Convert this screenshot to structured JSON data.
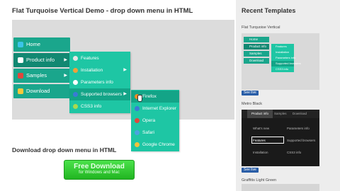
{
  "demo": {
    "title": "Flat Turquoise Vertical Demo - drop down menu in HTML",
    "menu": [
      {
        "label": "Home",
        "icon": "home-icon",
        "icon_color": "#3cc4e8",
        "has_sub": false
      },
      {
        "label": "Product info",
        "icon": "document-icon",
        "icon_color": "#ffffff",
        "has_sub": true
      },
      {
        "label": "Samples",
        "icon": "heart-icon",
        "icon_color": "#e0473d",
        "has_sub": true
      },
      {
        "label": "Download",
        "icon": "download-icon",
        "icon_color": "#f5c83a",
        "has_sub": false
      }
    ],
    "submenu": [
      {
        "label": "Features",
        "icon": "star-icon",
        "icon_color": "#e6e6e6",
        "has_sub": false
      },
      {
        "label": "Installation",
        "icon": "wrench-icon",
        "icon_color": "#f0a13a",
        "has_sub": true
      },
      {
        "label": "Parameters info",
        "icon": "list-icon",
        "icon_color": "#ffffff",
        "has_sub": false
      },
      {
        "label": "Supported browsers",
        "icon": "globe-icon",
        "icon_color": "#3a7bd5",
        "has_sub": true
      },
      {
        "label": "CSS3 info",
        "icon": "css-icon",
        "icon_color": "#a9d94e",
        "has_sub": false
      }
    ],
    "browsers": [
      {
        "label": "Firefox",
        "icon_color": "#f08a24"
      },
      {
        "label": "Internet Explorer",
        "icon_color": "#3a7bd5"
      },
      {
        "label": "Opera",
        "icon_color": "#e0473d"
      },
      {
        "label": "Safari",
        "icon_color": "#4aa3e0"
      },
      {
        "label": "Google Chrome",
        "icon_color": "#f3c23a"
      }
    ]
  },
  "download": {
    "title": "Download drop down menu in HTML",
    "button_main": "Free Download",
    "button_sub": "for Windows and Mac"
  },
  "sidebar": {
    "title": "Recent Templates",
    "templates": [
      {
        "name": "Flat Turquoise Vertical",
        "see_label": "See live",
        "menu": [
          "Home",
          "Product info",
          "Samples",
          "Download"
        ],
        "submenu": [
          "Features",
          "Installation",
          "Parameters info",
          "Supported browsers",
          "CSS3 info"
        ]
      },
      {
        "name": "Metro Black",
        "see_label": "See live",
        "tabs": [
          "Product info",
          "Samples",
          "Download"
        ],
        "rows": [
          [
            "What's new",
            "Parameters info"
          ],
          [
            "Features",
            "Supported browsers"
          ],
          [
            "Installation",
            "CSS3 info"
          ]
        ]
      },
      {
        "name": "Graffitis Light Green"
      }
    ]
  },
  "colors": {
    "menu_bg": "#1aa68c",
    "submenu_bg": "#1ec6a4",
    "download_green": "#2ac92a",
    "see_live_blue": "#2a5ea7"
  }
}
